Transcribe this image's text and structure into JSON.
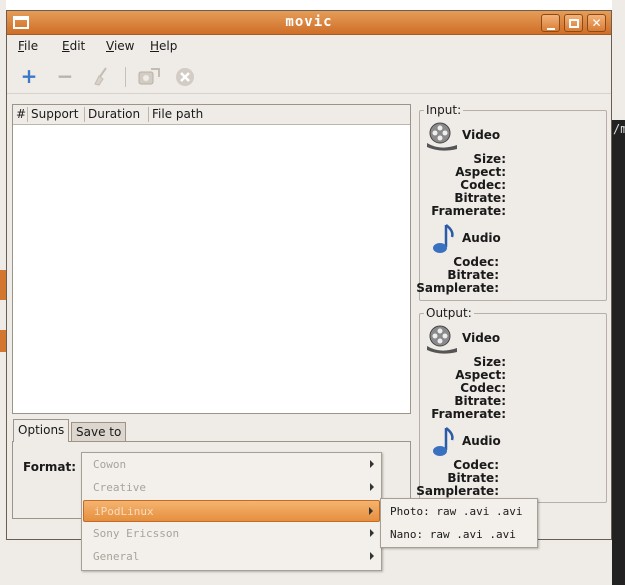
{
  "window": {
    "title": "movic"
  },
  "menubar": [
    {
      "pre": "",
      "u": "F",
      "post": "ile"
    },
    {
      "pre": "",
      "u": "E",
      "post": "dit"
    },
    {
      "pre": "",
      "u": "V",
      "post": "iew"
    },
    {
      "pre": "",
      "u": "H",
      "post": "elp"
    }
  ],
  "toolbar": {
    "add_icon": "plus-icon",
    "remove_icon": "minus-icon",
    "clear_icon": "broom-icon",
    "convert_icon": "convert-icon",
    "stop_icon": "stop-icon"
  },
  "filelist": {
    "columns": [
      "#",
      "Support",
      "Duration",
      "File path"
    ]
  },
  "tabs": {
    "options": "Options",
    "save_to": "Save to"
  },
  "options": {
    "format_label": "Format:"
  },
  "input": {
    "label": "Input",
    "video_title": "Video",
    "video_fields": [
      "Size:",
      "Aspect:",
      "Codec:",
      "Bitrate:",
      "Framerate:"
    ],
    "audio_title": "Audio",
    "audio_fields": [
      "Codec:",
      "Bitrate:",
      "Samplerate:"
    ]
  },
  "output": {
    "label": "Output",
    "video_title": "Video",
    "video_fields": [
      "Size:",
      "Aspect:",
      "Codec:",
      "Bitrate:",
      "Framerate:"
    ],
    "audio_title": "Audio",
    "audio_fields": [
      "Codec:",
      "Bitrate:",
      "Samplerate:"
    ]
  },
  "format_menu": {
    "items": [
      "Cowon",
      "Creative",
      "iPodLinux",
      "Sony Ericsson",
      "General"
    ],
    "selected": "iPodLinux"
  },
  "submenu": {
    "items": [
      "Photo: raw .avi .avi",
      "Nano: raw .avi  .avi"
    ]
  },
  "background": {
    "terminal_text": "/m"
  },
  "colors": {
    "titlebar": "#d97c36",
    "selection": "#ec9f52",
    "window_bg": "#efebe7"
  }
}
